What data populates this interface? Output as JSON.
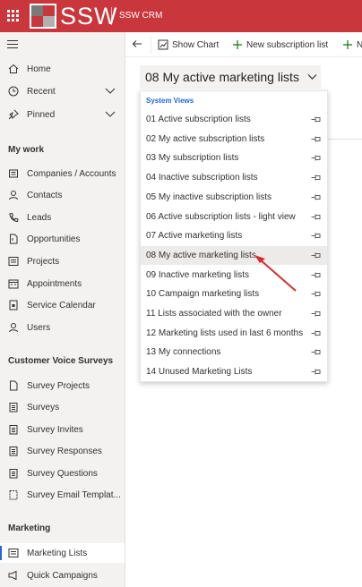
{
  "topbar": {
    "logo_text": "SSW",
    "app_name": "SSW CRM",
    "bg_color": "#c9373c"
  },
  "command_bar": {
    "show_chart": "Show Chart",
    "new_subscription_list": "New subscription list",
    "new_partial": "N"
  },
  "sidebar": {
    "top_items": [
      {
        "label": "Home",
        "icon": "home-icon"
      },
      {
        "label": "Recent",
        "icon": "clock-icon"
      },
      {
        "label": "Pinned",
        "icon": "pin-icon"
      }
    ],
    "sections": [
      {
        "title": "My work",
        "items": [
          {
            "label": "Companies / Accounts",
            "icon": "building-icon"
          },
          {
            "label": "Contacts",
            "icon": "person-icon"
          },
          {
            "label": "Leads",
            "icon": "phone-icon"
          },
          {
            "label": "Opportunities",
            "icon": "document-icon"
          },
          {
            "label": "Projects",
            "icon": "list-icon"
          },
          {
            "label": "Appointments",
            "icon": "calendar-icon"
          },
          {
            "label": "Service Calendar",
            "icon": "calendar-lock-icon"
          },
          {
            "label": "Users",
            "icon": "person-icon"
          }
        ]
      },
      {
        "title": "Customer Voice Surveys",
        "items": [
          {
            "label": "Survey Projects",
            "icon": "document-icon"
          },
          {
            "label": "Surveys",
            "icon": "clipboard-icon"
          },
          {
            "label": "Survey Invites",
            "icon": "clipboard-icon"
          },
          {
            "label": "Survey Responses",
            "icon": "clipboard-icon"
          },
          {
            "label": "Survey Questions",
            "icon": "clipboard-icon"
          },
          {
            "label": "Survey Email Templat...",
            "icon": "template-icon"
          }
        ]
      },
      {
        "title": "Marketing",
        "items": [
          {
            "label": "Marketing Lists",
            "icon": "list-icon",
            "selected": true
          },
          {
            "label": "Quick Campaigns",
            "icon": "campaign-icon"
          }
        ]
      }
    ]
  },
  "view_selector": {
    "title": "08 My active marketing lists"
  },
  "dropdown": {
    "header": "System Views",
    "items": [
      "01 Active subscription lists",
      "02 My active subscription lists",
      "03 My subscription lists",
      "04 Inactive subscription lists",
      "05 My inactive subscription lists",
      "06 Active subscription lists - light view",
      "07 Active marketing lists",
      "08 My active marketing lists",
      "09 Inactive marketing lists",
      "10 Campaign marketing lists",
      "11 Lists associated with the owner",
      "12 Marketing lists used in last 6 months",
      "13 My connections",
      "14 Unused Marketing Lists"
    ],
    "active_index": 7
  },
  "colors": {
    "accent": "#2266e3",
    "annotation_arrow": "#d32f2f"
  }
}
